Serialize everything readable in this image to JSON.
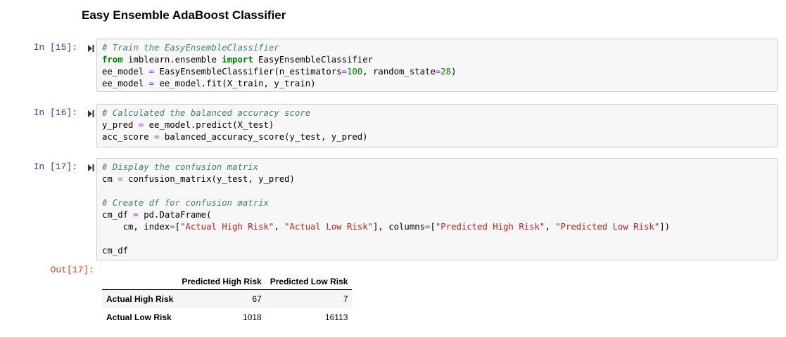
{
  "heading": "Easy Ensemble AdaBoost Classifier",
  "cells": [
    {
      "prompt": "In [15]:",
      "lines": [
        [
          [
            "cm",
            "# Train the EasyEnsembleClassifier"
          ]
        ],
        [
          [
            "kw",
            "from"
          ],
          [
            "",
            " imblearn.ensemble "
          ],
          [
            "kw",
            "import"
          ],
          [
            "",
            " EasyEnsembleClassifier"
          ]
        ],
        [
          [
            "",
            "ee_model "
          ],
          [
            "op",
            "="
          ],
          [
            "",
            " EasyEnsembleClassifier(n_estimators"
          ],
          [
            "op",
            "="
          ],
          [
            "num",
            "100"
          ],
          [
            "",
            ", random_state"
          ],
          [
            "op",
            "="
          ],
          [
            "num",
            "28"
          ],
          [
            "",
            ")"
          ]
        ],
        [
          [
            "",
            "ee_model "
          ],
          [
            "op",
            "="
          ],
          [
            "",
            " ee_model.fit(X_train, y_train)"
          ]
        ]
      ]
    },
    {
      "prompt": "In [16]:",
      "lines": [
        [
          [
            "cm",
            "# Calculated the balanced accuracy score"
          ]
        ],
        [
          [
            "",
            "y_pred "
          ],
          [
            "op",
            "="
          ],
          [
            "",
            " ee_model.predict(X_test)"
          ]
        ],
        [
          [
            "",
            "acc_score "
          ],
          [
            "op",
            "="
          ],
          [
            "",
            " balanced_accuracy_score(y_test, y_pred)"
          ]
        ]
      ]
    },
    {
      "prompt": "In [17]:",
      "lines": [
        [
          [
            "cm",
            "# Display the confusion matrix"
          ]
        ],
        [
          [
            "",
            "cm "
          ],
          [
            "op",
            "="
          ],
          [
            "",
            " confusion_matrix(y_test, y_pred)"
          ]
        ],
        [
          [
            "",
            ""
          ]
        ],
        [
          [
            "cm",
            "# Create df for confusion matrix"
          ]
        ],
        [
          [
            "",
            "cm_df "
          ],
          [
            "op",
            "="
          ],
          [
            "",
            " pd.DataFrame("
          ]
        ],
        [
          [
            "",
            "    cm, index"
          ],
          [
            "op",
            "="
          ],
          [
            "",
            "["
          ],
          [
            "str",
            "\"Actual High Risk\""
          ],
          [
            "",
            ", "
          ],
          [
            "str",
            "\"Actual Low Risk\""
          ],
          [
            "",
            "], columns"
          ],
          [
            "op",
            "="
          ],
          [
            "",
            "["
          ],
          [
            "str",
            "\"Predicted High Risk\""
          ],
          [
            "",
            ", "
          ],
          [
            "str",
            "\"Predicted Low Risk\""
          ],
          [
            "",
            "])"
          ]
        ],
        [
          [
            "",
            ""
          ]
        ],
        [
          [
            "",
            "cm_df"
          ]
        ]
      ]
    }
  ],
  "output": {
    "prompt": "Out[17]:",
    "columns": [
      "",
      "Predicted High Risk",
      "Predicted Low Risk"
    ],
    "rows": [
      {
        "label": "Actual High Risk",
        "values": [
          "67",
          "7"
        ]
      },
      {
        "label": "Actual Low Risk",
        "values": [
          "1018",
          "16113"
        ]
      }
    ]
  }
}
